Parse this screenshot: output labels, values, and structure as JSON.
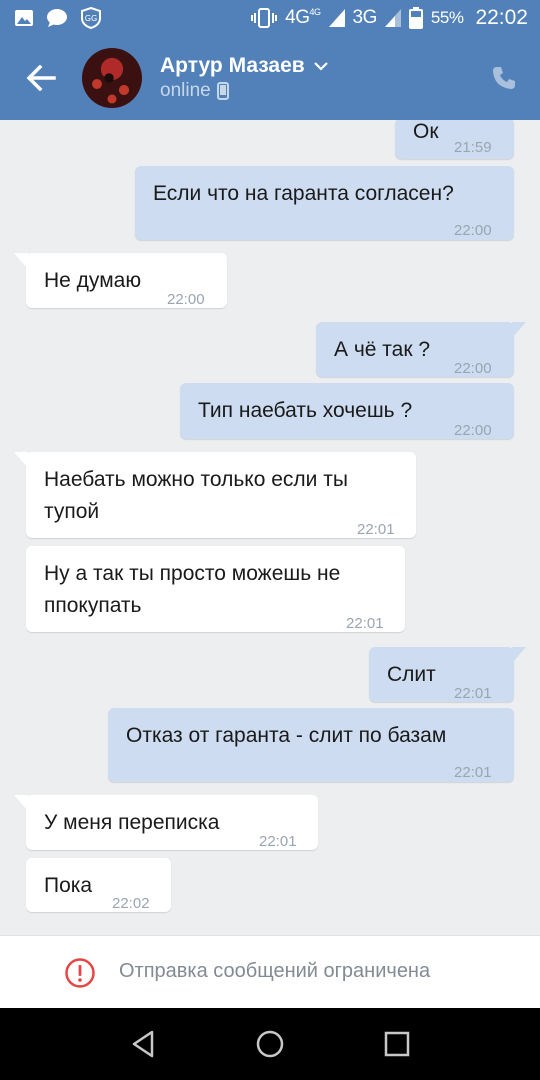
{
  "status_bar": {
    "network_4g": "4G",
    "network_4g_sup": "4G",
    "network_3g": "3G",
    "battery": "55%",
    "time": "22:02",
    "icons": [
      "image-icon",
      "message-bubble-icon",
      "shield-gg-icon",
      "vibrate-icon",
      "signal-icon",
      "battery-icon"
    ]
  },
  "header": {
    "name": "Артур Мазаев",
    "status": "online",
    "icons": [
      "back-arrow-icon",
      "chevron-down-icon",
      "mobile-device-icon",
      "phone-icon"
    ]
  },
  "messages": [
    {
      "dir": "out",
      "text": "Ок",
      "time": "21:59"
    },
    {
      "dir": "out",
      "text": "Если что на гаранта согласен?",
      "time": "22:00"
    },
    {
      "dir": "in",
      "text": "Не думаю",
      "time": "22:00"
    },
    {
      "dir": "out",
      "text": "А чё так ?",
      "time": "22:00"
    },
    {
      "dir": "out",
      "text": "Тип наебать хочешь ?",
      "time": "22:00"
    },
    {
      "dir": "in",
      "text": "Наебать можно только если ты\nтупой",
      "time": "22:01"
    },
    {
      "dir": "in",
      "text": "Ну а так ты просто можешь не\nппокупать",
      "time": "22:01"
    },
    {
      "dir": "out",
      "text": "Слит",
      "time": "22:01"
    },
    {
      "dir": "out",
      "text": "Отказ от гаранта - слит по базам",
      "time": "22:01"
    },
    {
      "dir": "in",
      "text": "У меня переписка",
      "time": "22:01"
    },
    {
      "dir": "in",
      "text": "Пока",
      "time": "22:02"
    }
  ],
  "footer": {
    "notice": "Отправка сообщений ограничена",
    "notice_icon": "alert-circle-icon"
  },
  "colors": {
    "header_bg": "#5181b8",
    "chat_bg": "#edeef0",
    "outgoing_bubble": "#cddcf0",
    "incoming_bubble": "#ffffff",
    "alert": "#e64646"
  },
  "nav": {
    "icons": [
      "back-triangle-icon",
      "home-circle-icon",
      "recents-square-icon"
    ]
  }
}
